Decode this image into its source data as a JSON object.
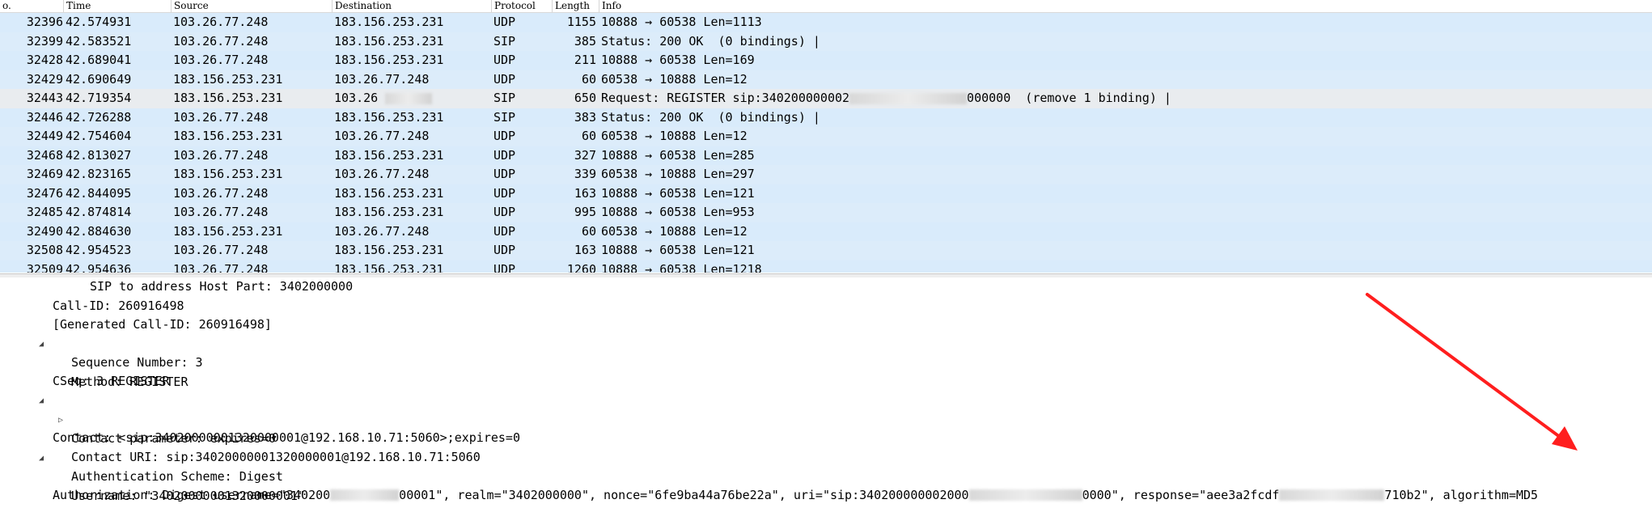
{
  "columns": {
    "no": "o.",
    "time": "Time",
    "source": "Source",
    "destination": "Destination",
    "protocol": "Protocol",
    "length": "Length",
    "info": "Info"
  },
  "packets": [
    {
      "no": "32396",
      "time": "42.574931",
      "src": "103.26.77.248",
      "dst": "183.156.253.231",
      "proto": "UDP",
      "len": "1155",
      "info": "10888 → 60538 Len=1113"
    },
    {
      "no": "32399",
      "time": "42.583521",
      "src": "103.26.77.248",
      "dst": "183.156.253.231",
      "proto": "SIP",
      "len": "385",
      "info": "Status: 200 OK  (0 bindings) |"
    },
    {
      "no": "32428",
      "time": "42.689041",
      "src": "103.26.77.248",
      "dst": "183.156.253.231",
      "proto": "UDP",
      "len": "211",
      "info": "10888 → 60538 Len=169"
    },
    {
      "no": "32429",
      "time": "42.690649",
      "src": "183.156.253.231",
      "dst": "103.26.77.248",
      "proto": "UDP",
      "len": "60",
      "info": "60538 → 10888 Len=12"
    },
    {
      "no": "32443",
      "time": "42.719354",
      "src": "183.156.253.231",
      "dst": "103.26",
      "proto": "SIP",
      "len": "650",
      "info_a": "Request: REGISTER sip:340200000002",
      "info_b": "000000  (remove 1 binding) |"
    },
    {
      "no": "32446",
      "time": "42.726288",
      "src": "103.26.77.248",
      "dst": "183.156.253.231",
      "proto": "SIP",
      "len": "383",
      "info": "Status: 200 OK  (0 bindings) |"
    },
    {
      "no": "32449",
      "time": "42.754604",
      "src": "183.156.253.231",
      "dst": "103.26.77.248",
      "proto": "UDP",
      "len": "60",
      "info": "60538 → 10888 Len=12"
    },
    {
      "no": "32468",
      "time": "42.813027",
      "src": "103.26.77.248",
      "dst": "183.156.253.231",
      "proto": "UDP",
      "len": "327",
      "info": "10888 → 60538 Len=285"
    },
    {
      "no": "32469",
      "time": "42.823165",
      "src": "183.156.253.231",
      "dst": "103.26.77.248",
      "proto": "UDP",
      "len": "339",
      "info": "60538 → 10888 Len=297"
    },
    {
      "no": "32476",
      "time": "42.844095",
      "src": "103.26.77.248",
      "dst": "183.156.253.231",
      "proto": "UDP",
      "len": "163",
      "info": "10888 → 60538 Len=121"
    },
    {
      "no": "32485",
      "time": "42.874814",
      "src": "103.26.77.248",
      "dst": "183.156.253.231",
      "proto": "UDP",
      "len": "995",
      "info": "10888 → 60538 Len=953"
    },
    {
      "no": "32490",
      "time": "42.884630",
      "src": "183.156.253.231",
      "dst": "103.26.77.248",
      "proto": "UDP",
      "len": "60",
      "info": "60538 → 10888 Len=12"
    },
    {
      "no": "32508",
      "time": "42.954523",
      "src": "103.26.77.248",
      "dst": "183.156.253.231",
      "proto": "UDP",
      "len": "163",
      "info": "10888 → 60538 Len=121"
    },
    {
      "no": "32509",
      "time": "42.954636",
      "src": "103.26.77.248",
      "dst": "183.156.253.231",
      "proto": "UDP",
      "len": "1260",
      "info": "10888 → 60538 Len=1218"
    }
  ],
  "details": {
    "sip_to_host": "SIP to address Host Part: 3402000000",
    "call_id": "Call-ID: 260916498",
    "generated_call_id": "[Generated Call-ID: 260916498]",
    "cseq": "CSeq: 3 REGISTER",
    "sequence_number": "Sequence Number: 3",
    "method": "Method: REGISTER",
    "contact": "Contact: <sip:34020000001320000001@192.168.10.71:5060>;expires=0",
    "contact_uri": "Contact URI: sip:34020000001320000001@192.168.10.71:5060",
    "contact_param": "Contact parameter: expires=0",
    "auth_a": "Authorization: Digest username=\"340200",
    "auth_b": "00001\", realm=\"3402000000\", nonce=\"6fe9ba44a76be22a\", uri=\"sip:340200000002000",
    "auth_c": "0000\", response=\"aee3a2fcdf",
    "auth_d": "710b2\", algorithm=MD5",
    "auth_scheme": "Authentication Scheme: Digest",
    "username": "Username: \"34020000001320000001\""
  },
  "colors": {
    "row_bg": "#d9ebfb",
    "selected_row_bg": "#e9ecef",
    "annotation_arrow": "#ff1e1e"
  }
}
